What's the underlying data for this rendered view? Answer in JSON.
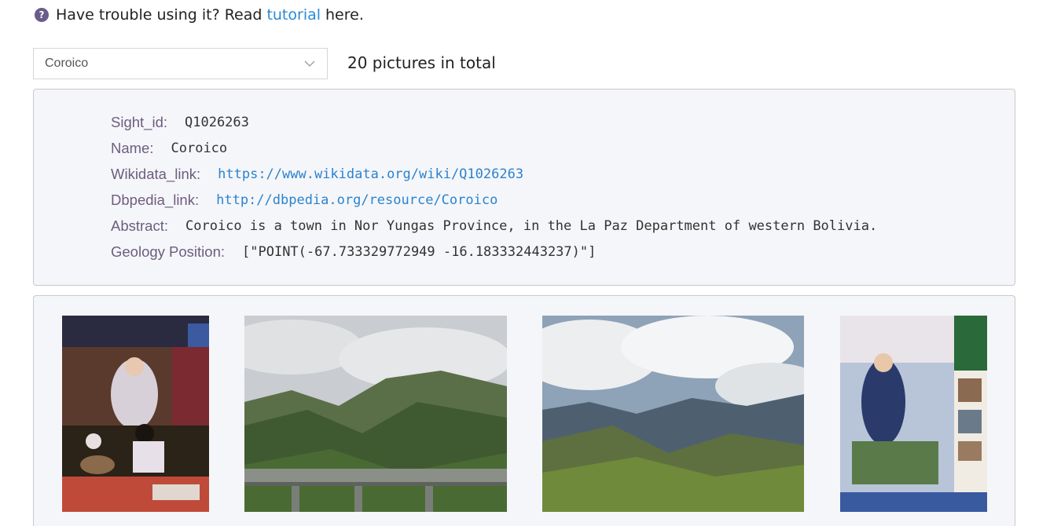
{
  "help": {
    "icon": "question-circle-icon",
    "prefix": "Have trouble using it? Read",
    "link_text": "tutorial",
    "suffix": "here."
  },
  "selector": {
    "selected": "Coroico",
    "icon": "chevron-down-icon"
  },
  "total_text": "20 pictures in total",
  "info": {
    "sight_id_label": "Sight_id:",
    "sight_id": "Q1026263",
    "name_label": "Name:",
    "name": "Coroico",
    "wikidata_label": "Wikidata_link:",
    "wikidata": "https://www.wikidata.org/wiki/Q1026263",
    "dbpedia_label": "Dbpedia_link:",
    "dbpedia": "http://dbpedia.org/resource/Coroico",
    "abstract_label": "Abstract:",
    "abstract": "Coroico is a town in Nor Yungas Province, in the La Paz Department of western Bolivia.",
    "geo_label": "Geology Position:",
    "geo": "[\"POINT(-67.733329772949 -16.183332443237)\"]"
  },
  "colors": {
    "accent_link": "#2b83cf",
    "label_purple": "#6e5c80",
    "card_bg": "#f5f6f9"
  }
}
